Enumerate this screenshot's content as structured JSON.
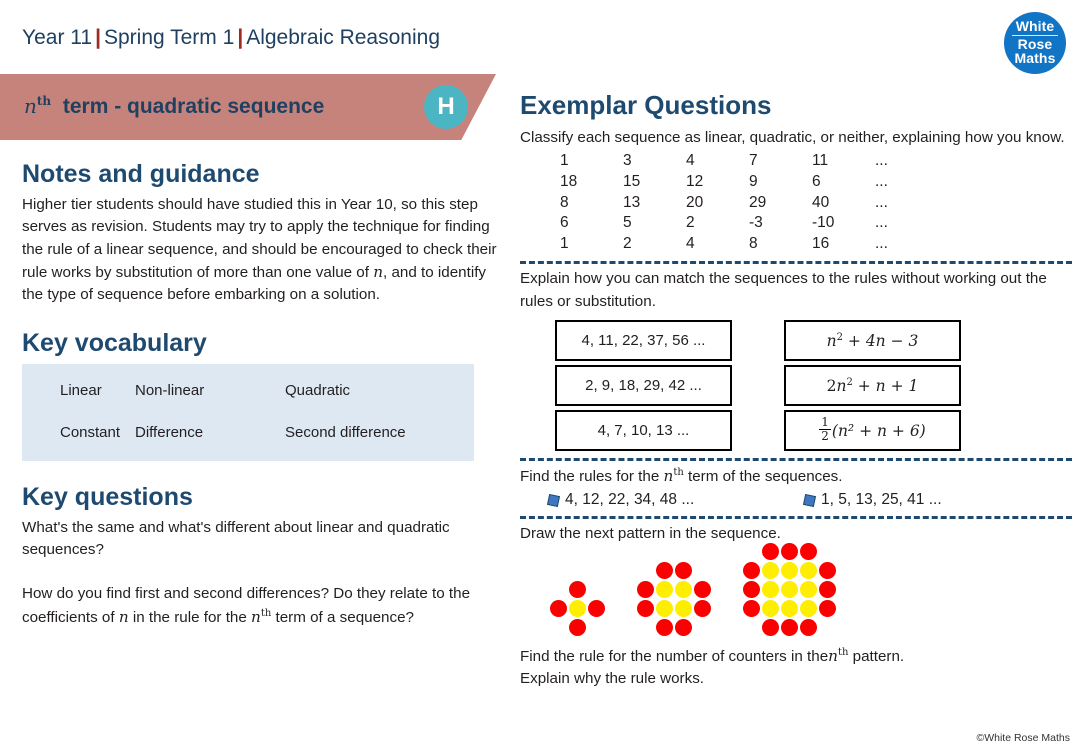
{
  "header": {
    "year": "Year 11",
    "term": "Spring Term 1",
    "topic": "Algebraic Reasoning",
    "separator": "|"
  },
  "logo": {
    "line1": "White",
    "line2": "Rose",
    "line3": "Maths"
  },
  "banner": {
    "title_prefix": "n",
    "title_sup": "th",
    "title_rest": "term - quadratic sequence",
    "tier_badge": "H",
    "banner_color": "#c6837c",
    "badge_color": "#4cb5c4"
  },
  "left": {
    "notes_heading": "Notes and guidance",
    "notes_text_part1": "Higher tier students should have studied this in Year 10, so this step serves as revision. Students may try to apply the technique for finding the rule of a linear sequence, and should be encouraged to check their rule works by substitution of more than one value of ",
    "notes_n": "n",
    "notes_text_part2": ", and to  identify the type of sequence before embarking on a solution.",
    "vocab_heading": "Key vocabulary",
    "vocab_rows": [
      [
        "Linear",
        "Non-linear",
        "Quadratic"
      ],
      [
        "Constant",
        "Difference",
        "Second difference"
      ]
    ],
    "vocab_box_color": "#dde8f2",
    "questions_heading": "Key questions",
    "question1": "What's the same and what's different about linear and quadratic sequences?",
    "question2_part1": "How do you find first and second differences? Do they relate to the coefficients of ",
    "question2_n": "n",
    "question2_part2": " in the rule for the  ",
    "question2_nth_n": "n",
    "question2_nth_sup": "th",
    "question2_part3": " term of a sequence?"
  },
  "right": {
    "exemplar_heading": "Exemplar Questions",
    "task1_text": "Classify each sequence as linear, quadratic, or neither, explaining how you know.",
    "sequences": [
      [
        "1",
        "3",
        "4",
        "7",
        "11",
        "..."
      ],
      [
        "18",
        "15",
        "12",
        "9",
        "6",
        "..."
      ],
      [
        "8",
        "13",
        "20",
        "29",
        "40",
        "..."
      ],
      [
        "6",
        "5",
        "2",
        "-3",
        "-10",
        "..."
      ],
      [
        "1",
        "2",
        "4",
        "8",
        "16",
        "..."
      ]
    ],
    "task2_text": "Explain how you can match the sequences to the rules without working out the rules or substitution.",
    "match_sequences": [
      "4, 11, 22, 37, 56 ...",
      "2, 9, 18, 29, 42 ...",
      "4, 7, 10, 13 ..."
    ],
    "match_rules": [
      {
        "type": "plain",
        "coef": "",
        "var": "n",
        "pow": "2",
        "rest": " + 4n − 3"
      },
      {
        "type": "plain",
        "coef": "2",
        "var": "n",
        "pow": "2",
        "rest": " + n + 1"
      },
      {
        "type": "fraction",
        "num": "1",
        "den": "2",
        "rest": "(n² + n + 6)"
      }
    ],
    "task3_text_part1": "Find the rules for the ",
    "task3_n": "n",
    "task3_sup": "th",
    "task3_text_part2": " term of the sequences.",
    "find_rules_items": [
      "4, 12, 22, 34, 48 ...",
      "1, 5, 13, 25, 41 ..."
    ],
    "task4_text": "Draw the next pattern in the sequence.",
    "pattern_counters": {
      "red_color": "#fb0000",
      "yellow_color": "#ffee00",
      "pattern1_yellow": 1,
      "pattern1_red": 4,
      "pattern2_yellow": 4,
      "pattern2_red": 8,
      "pattern3_yellow": 9,
      "pattern3_red": 12
    },
    "task5_text_part1": "Find the rule for the number of counters in the",
    "task5_n": "n",
    "task5_sup": "th",
    "task5_text_part2": " pattern.",
    "task5_text_line2": "Explain why the rule works."
  },
  "copyright": "©White Rose Maths"
}
